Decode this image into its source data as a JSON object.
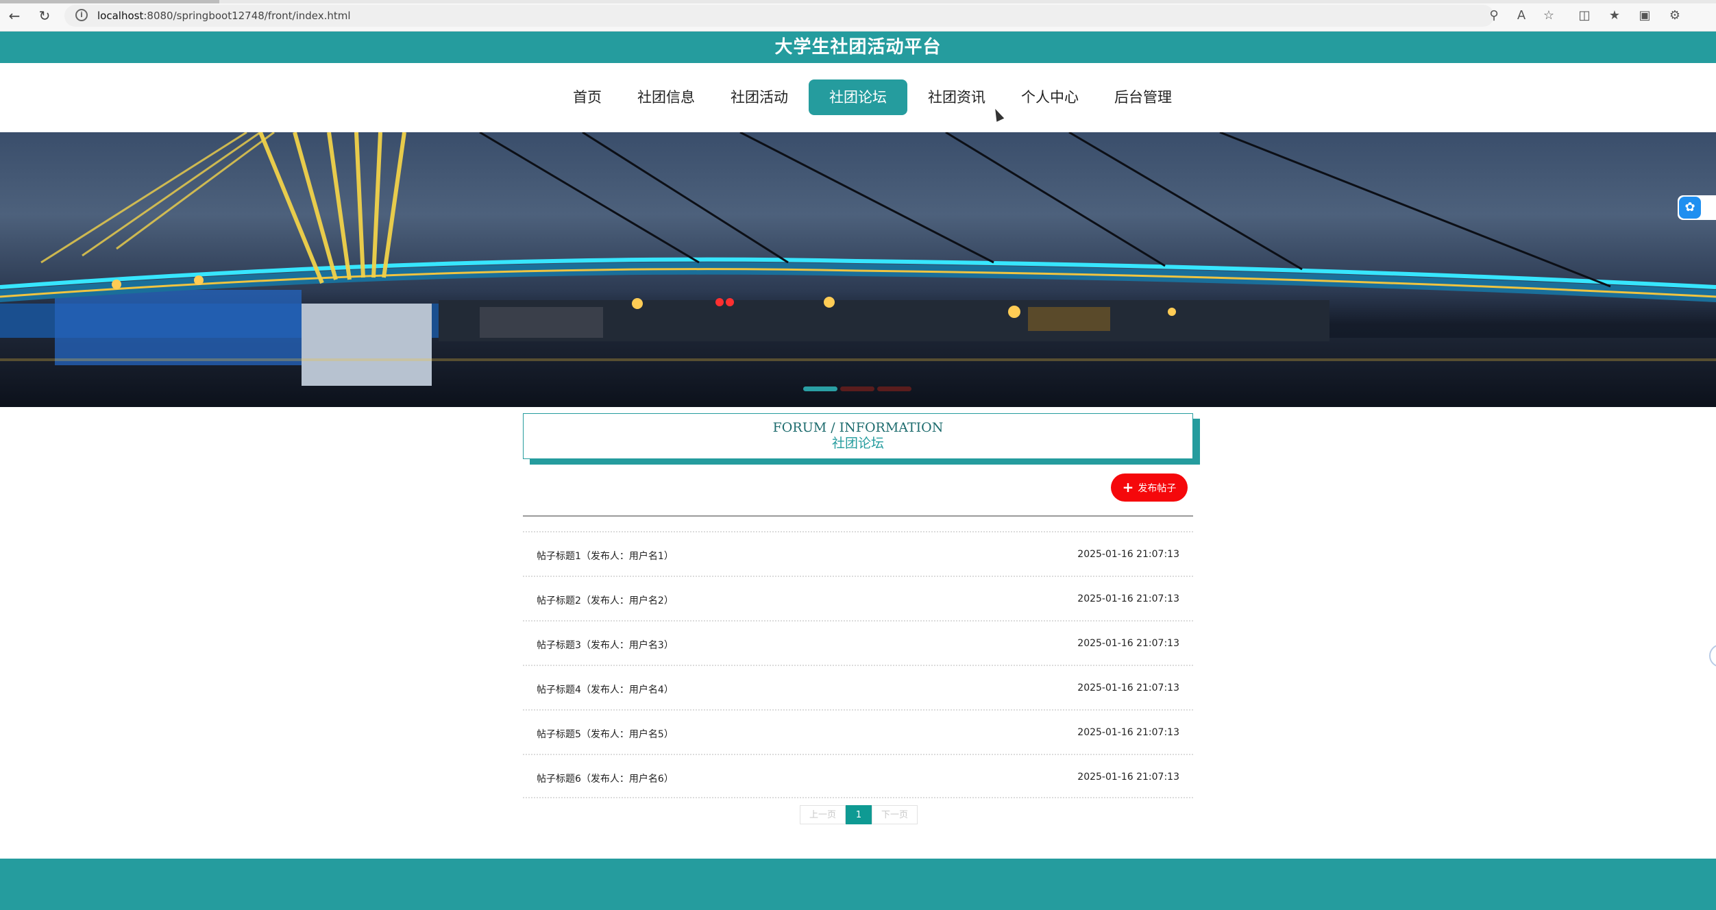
{
  "browser": {
    "url_host": "localhost",
    "url_rest": ":8080/springboot12748/front/index.html",
    "back_icon": "arrow-left-icon",
    "reload_icon": "reload-icon"
  },
  "site": {
    "title": "大学生社团活动平台"
  },
  "nav": {
    "items": [
      {
        "label": "首页"
      },
      {
        "label": "社团信息"
      },
      {
        "label": "社团活动"
      },
      {
        "label": "社团论坛",
        "active": true
      },
      {
        "label": "社团资讯"
      },
      {
        "label": "个人中心"
      },
      {
        "label": "后台管理"
      }
    ]
  },
  "banner": {
    "slide_count": 3,
    "active_slide": 1
  },
  "section": {
    "title_en": "FORUM / INFORMATION",
    "title_zh": "社团论坛"
  },
  "publish": {
    "label": "发布帖子"
  },
  "posts": [
    {
      "title": "帖子标题1（发布人：用户名1）",
      "time": "2025-01-16 21:07:13"
    },
    {
      "title": "帖子标题2（发布人：用户名2）",
      "time": "2025-01-16 21:07:13"
    },
    {
      "title": "帖子标题3（发布人：用户名3）",
      "time": "2025-01-16 21:07:13"
    },
    {
      "title": "帖子标题4（发布人：用户名4）",
      "time": "2025-01-16 21:07:13"
    },
    {
      "title": "帖子标题5（发布人：用户名5）",
      "time": "2025-01-16 21:07:13"
    },
    {
      "title": "帖子标题6（发布人：用户名6）",
      "time": "2025-01-16 21:07:13"
    }
  ],
  "pagination": {
    "prev": "上一页",
    "current": "1",
    "next": "下一页"
  },
  "colors": {
    "primary": "#259c9e",
    "publish": "#f5080b",
    "pager_active": "#0f9a93"
  }
}
